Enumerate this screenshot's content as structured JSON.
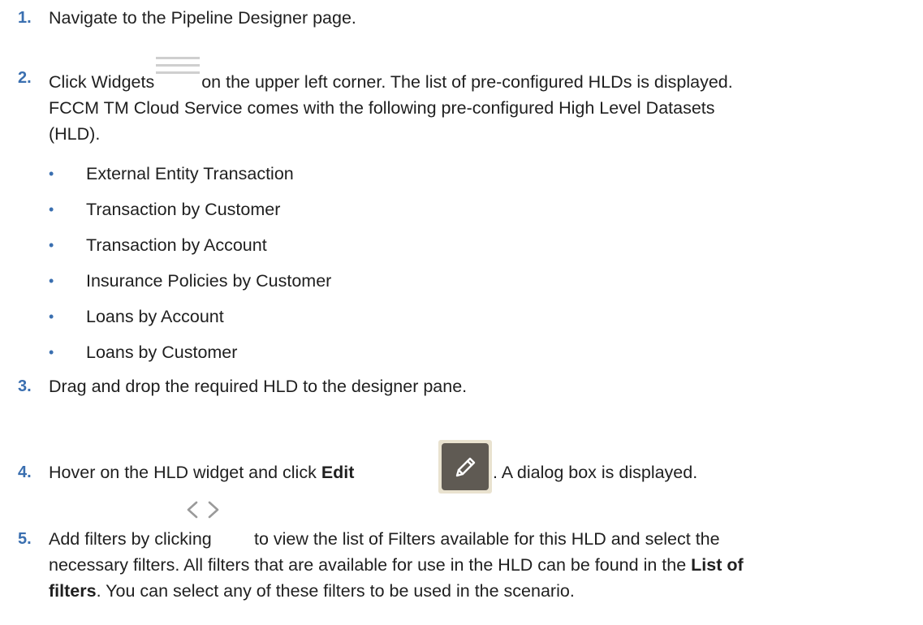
{
  "steps": [
    {
      "number": "1.",
      "text": "Navigate to the Pipeline Designer page."
    },
    {
      "number": "2.",
      "text_before_icon": "Click Widgets",
      "icon": "hamburger-menu-icon",
      "text_after_icon": "on the upper left corner. The list of pre-configured HLDs is displayed.",
      "text_line2": "FCCM TM Cloud Service comes with the following pre-configured High Level Datasets",
      "text_line3": "(HLD).",
      "bullets": [
        "External Entity Transaction",
        "Transaction by Customer",
        "Transaction by Account",
        "Insurance Policies by Customer",
        "Loans by Account",
        "Loans by Customer"
      ]
    },
    {
      "number": "3.",
      "text": "Drag and drop the required HLD to the designer pane."
    },
    {
      "number": "4.",
      "text_before_bold": "Hover on the HLD widget and click ",
      "bold": "Edit",
      "icon": "pencil-edit-icon",
      "text_after_icon": ". A dialog box is displayed."
    },
    {
      "number": "5.",
      "text_before_icon": "Add filters by clicking",
      "icon": "code-brackets-icon",
      "text_after_icon": "to view the list of Filters available for this HLD and select the",
      "text_line2_before_bold": "necessary filters. All filters that are available for use in the HLD can be found in the ",
      "text_line2_bold": "List of",
      "text_line3_bold": "filters",
      "text_line3_after_bold": ". You can select any of these filters to be used in the scenario."
    }
  ],
  "colors": {
    "step_number": "#3a6fb0",
    "body_text": "#1f1f1f",
    "edit_icon_bg": "#5f5a53",
    "edit_icon_border": "#e9e2cf",
    "widgets_icon": "#cfcfcf",
    "code_icon": "#9a9a9a"
  }
}
